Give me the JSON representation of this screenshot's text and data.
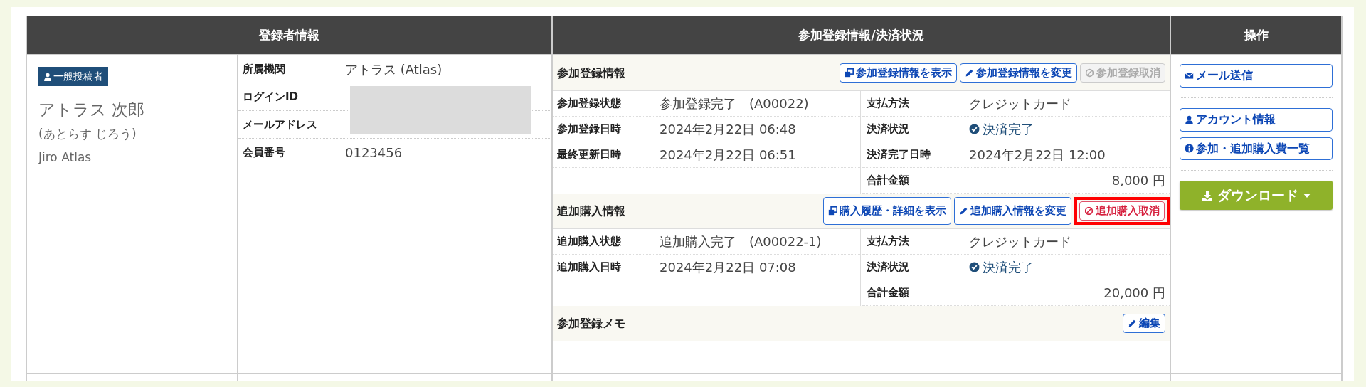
{
  "headers": [
    "登録者情報",
    "参加登録情報/決済状況",
    "操作"
  ],
  "registrant": {
    "role_badge": "一般投稿者",
    "name": "アトラス 次郎",
    "name_kana": "(あとらす じろう)",
    "name_en": "Jiro Atlas",
    "fields": [
      {
        "label": "所属機関",
        "value": "アトラス (Atlas)"
      },
      {
        "label": "ログインID",
        "redacted": true
      },
      {
        "label": "メールアドレス",
        "redacted": true
      },
      {
        "label": "会員番号",
        "value": "0123456"
      }
    ]
  },
  "sections": [
    {
      "title": "参加登録情報",
      "buttons": [
        {
          "label": "参加登録情報を表示",
          "kind": "view",
          "disabled": false,
          "highlighted": false
        },
        {
          "label": "参加登録情報を変更",
          "kind": "edit",
          "disabled": false,
          "highlighted": false
        },
        {
          "label": "参加登録取消",
          "kind": "cancel",
          "disabled": true,
          "highlighted": false
        }
      ],
      "left_rows": [
        {
          "label": "参加登録状態",
          "value": "参加登録完了　(A00022)"
        },
        {
          "label": "参加登録日時",
          "value": "2024年2月22日 06:48"
        },
        {
          "label": "最終更新日時",
          "value": "2024年2月22日 06:51"
        }
      ],
      "right_rows": [
        {
          "label": "支払方法",
          "value": "クレジットカード",
          "kind": "text"
        },
        {
          "label": "決済状況",
          "value": "決済完了",
          "kind": "status"
        },
        {
          "label": "決済完了日時",
          "value": "2024年2月22日 12:00",
          "kind": "text"
        },
        {
          "label": "合計金額",
          "value": "8,000 円",
          "kind": "amount"
        }
      ]
    },
    {
      "title": "追加購入情報",
      "buttons": [
        {
          "label": "購入履歴・詳細を表示",
          "kind": "view",
          "disabled": false,
          "highlighted": false
        },
        {
          "label": "追加購入情報を変更",
          "kind": "edit",
          "disabled": false,
          "highlighted": false
        },
        {
          "label": "追加購入取消",
          "kind": "cancel",
          "disabled": false,
          "highlighted": true
        }
      ],
      "left_rows": [
        {
          "label": "追加購入状態",
          "value": "追加購入完了　(A00022-1)"
        },
        {
          "label": "追加購入日時",
          "value": "2024年2月22日 07:08"
        }
      ],
      "right_rows": [
        {
          "label": "支払方法",
          "value": "クレジットカード",
          "kind": "text"
        },
        {
          "label": "決済状況",
          "value": "決済完了",
          "kind": "status"
        },
        {
          "label": "合計金額",
          "value": "20,000 円",
          "kind": "amount"
        }
      ]
    }
  ],
  "memo": {
    "title": "参加登録メモ",
    "button": "編集"
  },
  "actions": [
    [
      {
        "label": "メール送信",
        "kind": "mail"
      }
    ],
    [
      {
        "label": "アカウント情報",
        "kind": "account"
      },
      {
        "label": "参加・追加購入費一覧",
        "kind": "info"
      }
    ]
  ],
  "download": {
    "label": "ダウンロード"
  }
}
